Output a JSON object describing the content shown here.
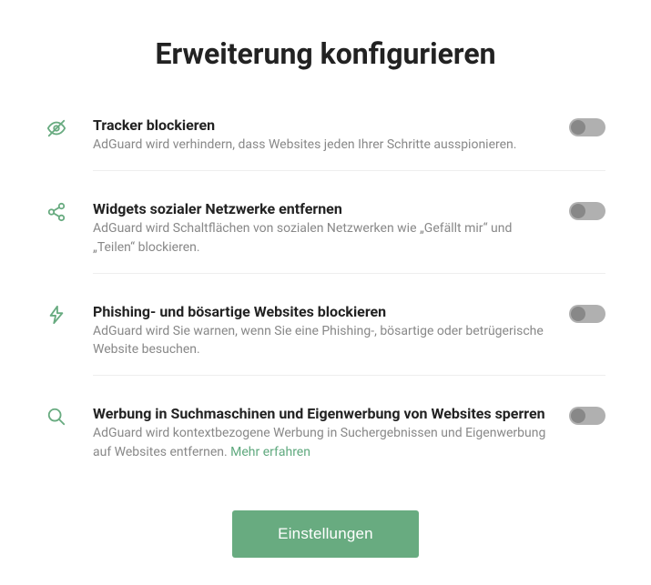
{
  "title": "Erweiterung konfigurieren",
  "settings": [
    {
      "title": "Tracker blockieren",
      "desc": "AdGuard wird verhindern, dass Websites jeden Ihrer Schritte ausspionieren.",
      "enabled": false
    },
    {
      "title": "Widgets sozialer Netzwerke entfernen",
      "desc": "AdGuard wird Schaltflächen von sozialen Netzwerken wie „Gefällt mir“ und „Teilen“ blockieren.",
      "enabled": false
    },
    {
      "title": "Phishing- und bösartige Websites blockieren",
      "desc": "AdGuard wird Sie warnen, wenn Sie eine Phishing-, bösartige oder betrügerische Website besuchen.",
      "enabled": false
    },
    {
      "title": "Werbung in Suchmaschinen und Eigenwerbung von Websites sperren",
      "desc": "AdGuard wird kontextbezogene Werbung in Suchergebnissen und Eigenwerbung auf Websites entfernen. ",
      "learn_more": "Mehr erfahren",
      "enabled": false
    }
  ],
  "settings_button": "Einstellungen",
  "colors": {
    "accent": "#68ab80",
    "link": "#5fa97e"
  }
}
